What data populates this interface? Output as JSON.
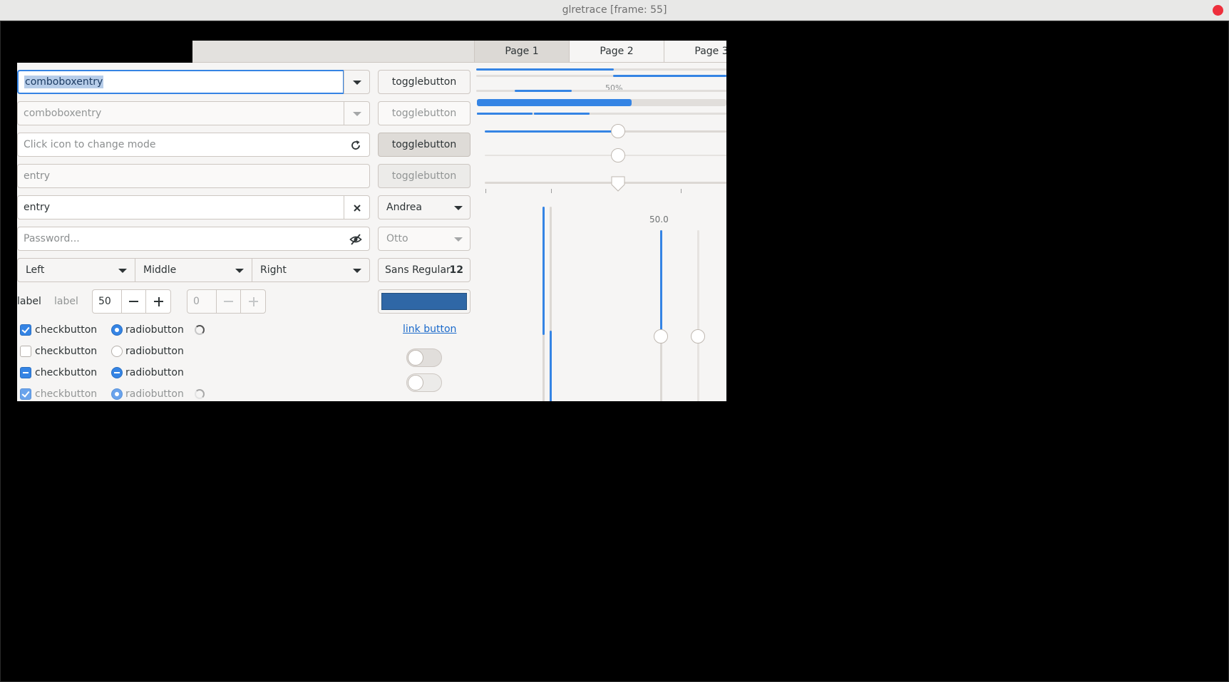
{
  "window": {
    "title": "glretrace [frame: 55]"
  },
  "tabs": [
    {
      "label": "Page 1",
      "underline": "1",
      "prefix": "Page "
    },
    {
      "label": "Page 2",
      "underline": "2",
      "prefix": "Page "
    },
    {
      "label": "Page 3",
      "underline": "3",
      "prefix": "Page "
    }
  ],
  "left": {
    "combo1_value": "comboboxentry",
    "combo2_value": "comboboxentry",
    "mode_entry_placeholder": "Click icon to change mode",
    "entry_disabled_placeholder": "entry",
    "entry_value": "entry",
    "password_placeholder": "Password...",
    "combo_left": "Left",
    "combo_middle": "Middle",
    "combo_right": "Right",
    "label1": "label",
    "label2": "label",
    "spin1_value": "50",
    "spin2_value": "0",
    "checks": [
      "checkbutton",
      "checkbutton",
      "checkbutton",
      "checkbutton"
    ],
    "radios": [
      "radiobutton",
      "radiobutton",
      "radiobutton",
      "radiobutton"
    ]
  },
  "middle": {
    "toggle1": "togglebutton",
    "toggle2": "togglebutton",
    "toggle3": "togglebutton",
    "toggle4": "togglebutton",
    "combo_andrea": "Andrea",
    "combo_otto": "Otto",
    "font_name": "Sans Regular",
    "font_size": "12",
    "color_value": "#2f67a6",
    "link": "link button"
  },
  "right": {
    "progress_label": "50%",
    "vscale_value": "50.0",
    "progress_main": 0.5,
    "level_bar": 0.6,
    "scale1": 0.5,
    "scale2": 0.5,
    "scale3": 0.5
  },
  "colors": {
    "accent": "#3584e4",
    "close": "#ee2f3c",
    "link": "#1b6acb"
  }
}
